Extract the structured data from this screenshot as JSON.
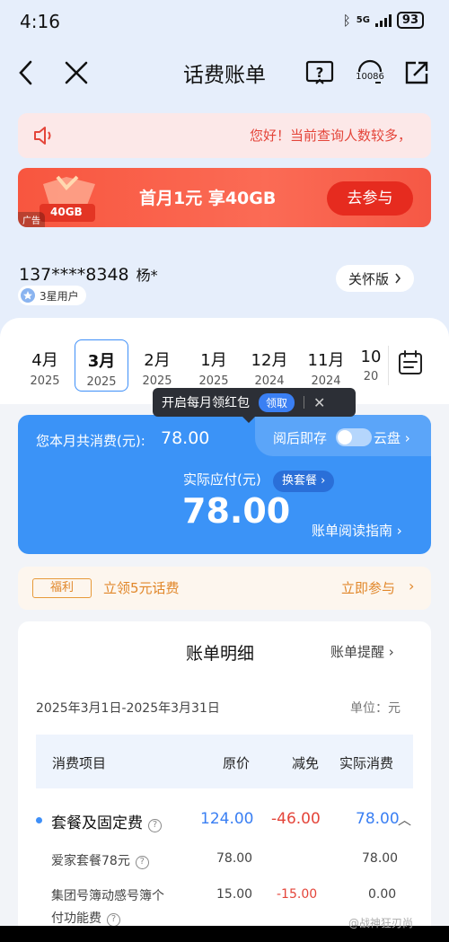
{
  "status": {
    "time": "4:16",
    "network": "5G",
    "battery": "93"
  },
  "nav": {
    "title": "话费账单",
    "service_number": "10086"
  },
  "notice": {
    "text": "您好！当前查询人数较多，"
  },
  "ad": {
    "gift_label": "40GB",
    "title": "首月1元 享40GB",
    "button": "去参与",
    "tag": "广告"
  },
  "user": {
    "phone": "137****8348",
    "name": "杨*",
    "level": "3星用户",
    "care_label": "关怀版"
  },
  "months": [
    {
      "m": "4月",
      "y": "2025"
    },
    {
      "m": "3月",
      "y": "2025"
    },
    {
      "m": "2月",
      "y": "2025"
    },
    {
      "m": "1月",
      "y": "2025"
    },
    {
      "m": "12月",
      "y": "2024"
    },
    {
      "m": "11月",
      "y": "2024"
    },
    {
      "m": "10",
      "y": "20"
    }
  ],
  "tooltip": {
    "text": "开启每月领红包",
    "claim": "领取"
  },
  "bill": {
    "total_label": "您本月共消费(元):",
    "total_value": "78.00",
    "read_store": "阅后即存",
    "cloud": "云盘",
    "pay_label": "实际应付(元)",
    "change_pkg": "换套餐",
    "pay_value": "78.00",
    "guide": "账单阅读指南"
  },
  "welfare": {
    "tag": "福利",
    "text": "立领5元话费",
    "join": "立即参与"
  },
  "detail": {
    "title": "账单明细",
    "remind": "账单提醒",
    "period": "2025年3月1日-2025年3月31日",
    "unit": "单位：元",
    "headers": {
      "item": "消费项目",
      "original": "原价",
      "discount": "减免",
      "actual": "实际消费"
    },
    "group": {
      "name": "套餐及固定费",
      "original": "124.00",
      "discount": "-46.00",
      "actual": "78.00"
    },
    "rows": [
      {
        "name": "爱家套餐78元",
        "original": "78.00",
        "discount": "",
        "actual": "78.00"
      },
      {
        "name_line1": "集团号簿动感号簿个",
        "name_line2": "付功能费",
        "original": "15.00",
        "discount": "-15.00",
        "actual": "0.00"
      }
    ]
  },
  "watermark": "@战神狂刃尚",
  "colors": {
    "accent": "#3b93f7",
    "danger": "#e4453a",
    "warning": "#e1872a"
  }
}
